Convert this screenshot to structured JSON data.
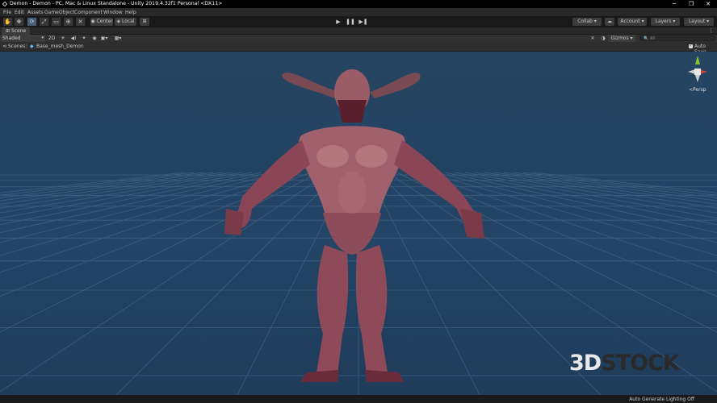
{
  "window": {
    "title": "Demon - Demon - PC, Mac & Linux Standalone - Unity 2019.4.32f1 Personal <DX11>",
    "minimize": "─",
    "maximize": "❐",
    "close": "✕"
  },
  "menu": [
    "File",
    "Edit",
    "Assets",
    "GameObject",
    "Component",
    "Window",
    "Help"
  ],
  "toolbar": {
    "pivot": "Center",
    "space": "Local",
    "collab": "Collab",
    "account": "Account",
    "layers": "Layers",
    "layout": "Layout"
  },
  "scene_tab": {
    "label": "Scene"
  },
  "scene_toolbar": {
    "shading": "Shaded",
    "mode_2d": "2D",
    "gizmos": "Gizmos",
    "search": "All"
  },
  "breadcrumb": {
    "root": "Scenes",
    "current": "Base_mesh_Demon",
    "auto_save": "Auto Save"
  },
  "viewport": {
    "gizmo_label": "Persp",
    "sky_color": "#254562",
    "grid_color": "#4f6f8f"
  },
  "watermark": {
    "part1": "3D",
    "part2": "STOCK"
  },
  "status": {
    "text": "Auto Generate Lighting Off"
  }
}
